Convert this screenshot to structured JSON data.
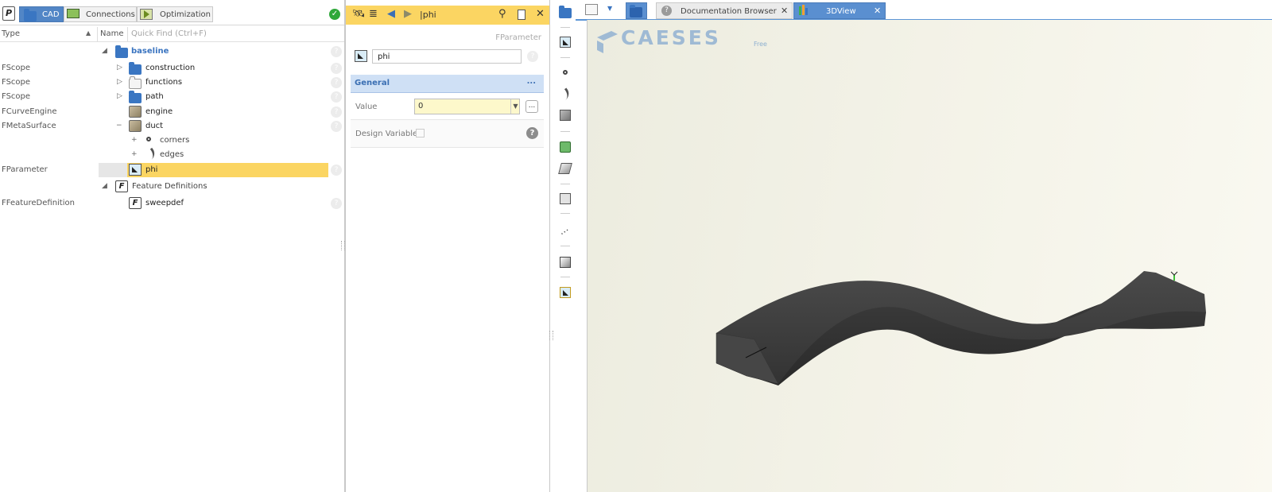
{
  "left": {
    "tabs": [
      {
        "label": "CAD",
        "icon": "folder-icon"
      },
      {
        "label": "Connections",
        "icon": "monitor-icon"
      },
      {
        "label": "Optimization",
        "icon": "play-icon"
      }
    ],
    "header": {
      "type": "Type",
      "name": "Name",
      "search_placeholder": "Quick Find (Ctrl+F)"
    },
    "rows": [
      {
        "type": "",
        "name": "baseline",
        "icon": "folder-icon",
        "expander": "◢"
      },
      {
        "type": "FScope",
        "name": "construction",
        "icon": "folder-icon",
        "expander": "▷"
      },
      {
        "type": "FScope",
        "name": "functions",
        "icon": "folder-icon",
        "expander": "▷"
      },
      {
        "type": "FScope",
        "name": "path",
        "icon": "folder-icon",
        "expander": "▷"
      },
      {
        "type": "FCurveEngine",
        "name": "engine",
        "icon": "surface-icon",
        "expander": ""
      },
      {
        "type": "FMetaSurface",
        "name": "duct",
        "icon": "surface-icon",
        "expander": "−"
      },
      {
        "type": "",
        "name": "corners",
        "icon": "point-icon",
        "expander": "+"
      },
      {
        "type": "",
        "name": "edges",
        "icon": "edge-icon",
        "expander": "+"
      },
      {
        "type": "FParameter",
        "name": "phi",
        "icon": "parameter-icon",
        "expander": ""
      },
      {
        "type": "",
        "name": "Feature Definitions",
        "icon": "f-icon",
        "expander": "◢"
      },
      {
        "type": "FFeatureDefinition",
        "name": "sweepdef",
        "icon": "f-icon",
        "expander": ""
      }
    ]
  },
  "middle": {
    "toolbar_title": "|phi",
    "type_label": "FParameter",
    "name_value": "phi",
    "section": "General",
    "section_more": "...",
    "value_label": "Value",
    "value": "0",
    "more_label": "...",
    "design_variable_label": "Design Variable"
  },
  "right": {
    "tabs": [
      {
        "label": "Documentation Browser",
        "close": "✕"
      },
      {
        "label": "3DView",
        "close": "✕"
      }
    ],
    "logo_text": "CAESES",
    "logo_suffix": "Free"
  },
  "colors": {
    "accent": "#5286c6",
    "highlight": "#fbd562",
    "model": "#3f3f3f"
  }
}
